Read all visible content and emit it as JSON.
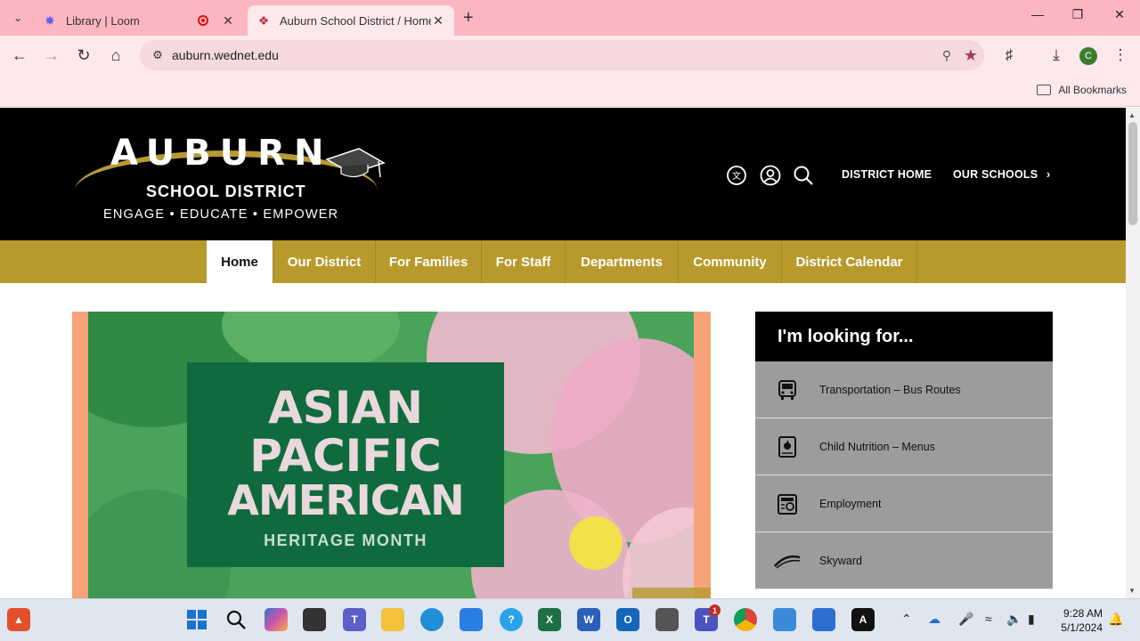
{
  "browser": {
    "tabs": [
      {
        "title": "Library | Loom",
        "favicon": "loom-icon"
      },
      {
        "title": "Auburn School District / Homep",
        "favicon": "district-icon",
        "active": true
      }
    ],
    "url": "auburn.wednet.edu",
    "all_bookmarks": "All Bookmarks",
    "profile_initial": "C",
    "accent": "#fbb6c1"
  },
  "header": {
    "logo_name": "AUBURN",
    "logo_subtitle": "SCHOOL DISTRICT",
    "logo_tagline": "ENGAGE • EDUCATE • EMPOWER",
    "links": {
      "district_home": "DISTRICT HOME",
      "our_schools": "OUR SCHOOLS"
    },
    "icons": [
      "translate-icon",
      "user-icon",
      "search-icon"
    ]
  },
  "nav": {
    "items": [
      "Home",
      "Our District",
      "For Families",
      "For Staff",
      "Departments",
      "Community",
      "District Calendar"
    ],
    "active": "Home",
    "color": "#b89a2c"
  },
  "hero": {
    "line1": "ASIAN",
    "line2": "PACIFIC",
    "line3": "AMERICAN",
    "line4": "HERITAGE MONTH"
  },
  "looking_for": {
    "title": "I'm looking for...",
    "items": [
      {
        "label": "Transportation – Bus Routes",
        "icon": "bus-icon"
      },
      {
        "label": "Child Nutrition – Menus",
        "icon": "apple-tray-icon"
      },
      {
        "label": "Employment",
        "icon": "jobs-newspaper-icon"
      },
      {
        "label": "Skyward",
        "icon": "skyward-logo-icon"
      }
    ]
  },
  "taskbar": {
    "time": "9:28 AM",
    "date": "5/1/2024",
    "teams_badge": "1"
  }
}
